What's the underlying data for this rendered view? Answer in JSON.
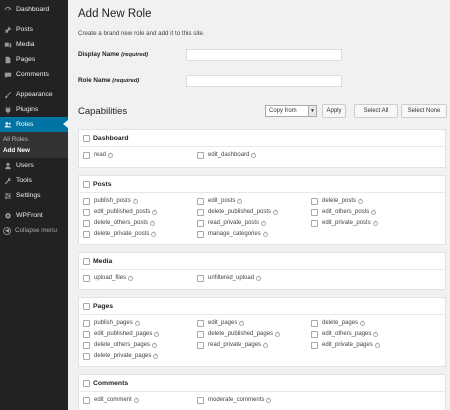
{
  "sidebar": {
    "items": [
      {
        "key": "dashboard",
        "label": "Dashboard",
        "icon": "dashboard-icon"
      },
      {
        "key": "posts",
        "label": "Posts",
        "icon": "pin-icon"
      },
      {
        "key": "media",
        "label": "Media",
        "icon": "media-icon"
      },
      {
        "key": "pages",
        "label": "Pages",
        "icon": "pages-icon"
      },
      {
        "key": "comments",
        "label": "Comments",
        "icon": "comment-icon"
      },
      {
        "key": "appearance",
        "label": "Appearance",
        "icon": "brush-icon"
      },
      {
        "key": "plugins",
        "label": "Plugins",
        "icon": "plugin-icon"
      },
      {
        "key": "roles",
        "label": "Roles",
        "icon": "users-icon"
      },
      {
        "key": "users",
        "label": "Users",
        "icon": "user-icon"
      },
      {
        "key": "tools",
        "label": "Tools",
        "icon": "wrench-icon"
      },
      {
        "key": "settings",
        "label": "Settings",
        "icon": "settings-icon"
      },
      {
        "key": "wpfront",
        "label": "WPFront",
        "icon": "gear-icon"
      },
      {
        "key": "collapse",
        "label": "Collapse menu",
        "icon": "collapse-icon"
      }
    ],
    "submenu": [
      "All Roles",
      "Add New"
    ],
    "active_color": "#0074a2"
  },
  "main": {
    "title": "Add New Role",
    "description": "Create a brand new role and add it to this site.",
    "display_name": {
      "label": "Display Name",
      "required": "(required)",
      "value": ""
    },
    "role_name": {
      "label": "Role Name",
      "required": "(required)",
      "value": ""
    },
    "capabilities_title": "Capabilities",
    "copy_from": "Copy from",
    "apply_label": "Apply",
    "select_all_label": "Select All",
    "select_none_label": "Select None"
  },
  "groups": [
    {
      "name": "Dashboard",
      "caps": [
        "read",
        "edit_dashboard"
      ]
    },
    {
      "name": "Posts",
      "caps": [
        "publish_posts",
        "edit_posts",
        "delete_posts",
        "edit_published_posts",
        "delete_published_posts",
        "edit_others_posts",
        "delete_others_posts",
        "read_private_posts",
        "edit_private_posts",
        "delete_private_posts",
        "manage_categories"
      ]
    },
    {
      "name": "Media",
      "caps": [
        "upload_files",
        "unfiltered_upload"
      ]
    },
    {
      "name": "Pages",
      "caps": [
        "publish_pages",
        "edit_pages",
        "delete_pages",
        "edit_published_pages",
        "delete_published_pages",
        "edit_others_pages",
        "delete_others_pages",
        "read_private_pages",
        "edit_private_pages",
        "delete_private_pages"
      ]
    },
    {
      "name": "Comments",
      "caps": [
        "edit_comment",
        "moderate_comments"
      ]
    }
  ]
}
